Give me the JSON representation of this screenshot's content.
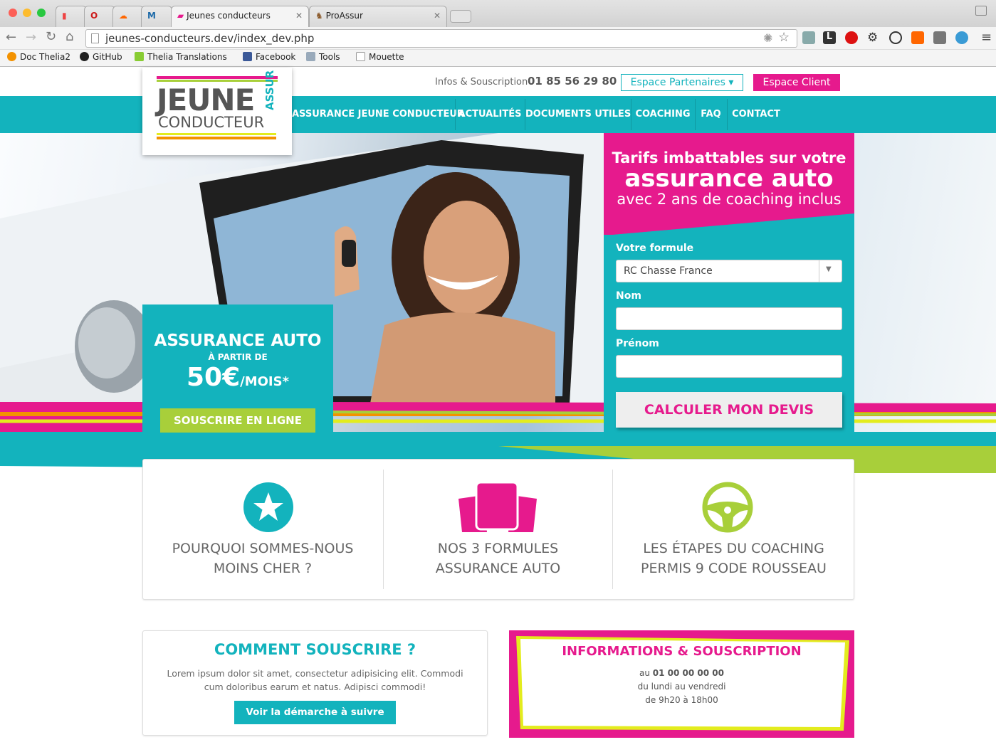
{
  "browser": {
    "tabs": [
      {
        "label": ""
      },
      {
        "label": ""
      },
      {
        "label": ""
      },
      {
        "label": ""
      },
      {
        "label": "Jeunes conducteurs"
      },
      {
        "label": "ProAssur"
      }
    ],
    "url": "jeunes-conducteurs.dev/index_dev.php",
    "bookmarks": [
      "Doc Thelia2",
      "GitHub",
      "Thelia Translations",
      "Facebook",
      "Tools",
      "Mouette"
    ]
  },
  "header": {
    "info_label": "Infos & Souscription",
    "phone": "01 85 56 29 80",
    "partners_button": "Espace Partenaires ▾",
    "client_button": "Espace Client"
  },
  "logo": {
    "line1": "JEUNE",
    "line2": "CONDUCTEUR",
    "side": "ASSUR"
  },
  "nav": [
    "ASSURANCE JEUNE CONDUCTEUR",
    "ACTUALITÉS",
    "DOCUMENTS UTILES",
    "COACHING",
    "FAQ",
    "CONTACT"
  ],
  "offer": {
    "title": "ASSURANCE AUTO",
    "from": "À PARTIR DE",
    "price": "50€",
    "per": "/MOIS*",
    "button": "SOUSCRIRE EN LIGNE"
  },
  "quote_form": {
    "headline1": "Tarifs imbattables sur votre",
    "headline2": "assurance auto",
    "headline3": "avec 2 ans de coaching inclus",
    "formula_label": "Votre formule",
    "formula_value": "RC Chasse France",
    "name_label": "Nom",
    "firstname_label": "Prénom",
    "submit": "CALCULER MON DEVIS"
  },
  "cards": [
    {
      "icon": "star-icon",
      "line1": "POURQUOI SOMMES-NOUS",
      "line2": "MOINS CHER ?"
    },
    {
      "icon": "cards-icon",
      "line1": "NOS 3 FORMULES",
      "line2": "ASSURANCE AUTO"
    },
    {
      "icon": "steering-wheel-icon",
      "line1": "LES ÉTAPES DU COACHING",
      "line2": "PERMIS 9 CODE ROUSSEAU"
    }
  ],
  "how": {
    "title": "COMMENT SOUSCRIRE ?",
    "body": "Lorem ipsum dolor sit amet, consectetur adipisicing elit. Commodi cum doloribus earum et natus. Adipisci commodi!",
    "button": "Voir la démarche à suivre"
  },
  "info": {
    "title": "INFORMATIONS & SOUSCRIPTION",
    "phone_prefix": "au ",
    "phone": "01 00 00 00 00",
    "days": "du lundi au vendredi",
    "hours": "de 9h20 à 18h00"
  },
  "colors": {
    "teal": "#13b3bd",
    "pink": "#e61a8d",
    "green": "#a8cf3a",
    "orange": "#f39200",
    "yellow": "#e3ec1e"
  }
}
